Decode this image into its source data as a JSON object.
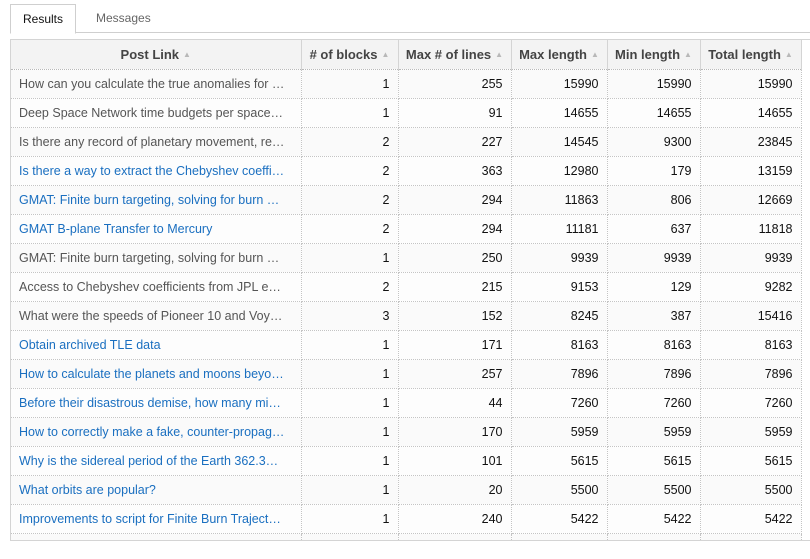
{
  "tabs": [
    {
      "label": "Results",
      "active": true
    },
    {
      "label": "Messages",
      "active": false
    }
  ],
  "table": {
    "columns": [
      "Post Link",
      "# of blocks",
      "Max # of lines",
      "Max length",
      "Min length",
      "Total length"
    ],
    "sort_indicator": "▲",
    "rows": [
      {
        "post": "How can you calculate the true anomalies for …",
        "link": false,
        "blocks": "1",
        "max_lines": "255",
        "max_len": "15990",
        "min_len": "15990",
        "total": "15990"
      },
      {
        "post": "Deep Space Network time budgets per space…",
        "link": false,
        "blocks": "1",
        "max_lines": "91",
        "max_len": "14655",
        "min_len": "14655",
        "total": "14655"
      },
      {
        "post": "Is there any record of planetary movement, re…",
        "link": false,
        "blocks": "2",
        "max_lines": "227",
        "max_len": "14545",
        "min_len": "9300",
        "total": "23845"
      },
      {
        "post": "Is there a way to extract the Chebyshev coeffi…",
        "link": true,
        "blocks": "2",
        "max_lines": "363",
        "max_len": "12980",
        "min_len": "179",
        "total": "13159"
      },
      {
        "post": "GMAT: Finite burn targeting, solving for burn …",
        "link": true,
        "blocks": "2",
        "max_lines": "294",
        "max_len": "11863",
        "min_len": "806",
        "total": "12669"
      },
      {
        "post": "GMAT B-plane Transfer to Mercury",
        "link": true,
        "blocks": "2",
        "max_lines": "294",
        "max_len": "11181",
        "min_len": "637",
        "total": "11818"
      },
      {
        "post": "GMAT: Finite burn targeting, solving for burn …",
        "link": false,
        "blocks": "1",
        "max_lines": "250",
        "max_len": "9939",
        "min_len": "9939",
        "total": "9939"
      },
      {
        "post": "Access to Chebyshev coefficients from JPL e…",
        "link": false,
        "blocks": "2",
        "max_lines": "215",
        "max_len": "9153",
        "min_len": "129",
        "total": "9282"
      },
      {
        "post": "What were the speeds of Pioneer 10 and Voy…",
        "link": false,
        "blocks": "3",
        "max_lines": "152",
        "max_len": "8245",
        "min_len": "387",
        "total": "15416"
      },
      {
        "post": "Obtain archived TLE data",
        "link": true,
        "blocks": "1",
        "max_lines": "171",
        "max_len": "8163",
        "min_len": "8163",
        "total": "8163"
      },
      {
        "post": "How to calculate the planets and moons beyo…",
        "link": true,
        "blocks": "1",
        "max_lines": "257",
        "max_len": "7896",
        "min_len": "7896",
        "total": "7896"
      },
      {
        "post": "Before their disastrous demise, how many mi…",
        "link": true,
        "blocks": "1",
        "max_lines": "44",
        "max_len": "7260",
        "min_len": "7260",
        "total": "7260"
      },
      {
        "post": "How to correctly make a fake, counter-propag…",
        "link": true,
        "blocks": "1",
        "max_lines": "170",
        "max_len": "5959",
        "min_len": "5959",
        "total": "5959"
      },
      {
        "post": "Why is the sidereal period of the Earth 362.3…",
        "link": true,
        "blocks": "1",
        "max_lines": "101",
        "max_len": "5615",
        "min_len": "5615",
        "total": "5615"
      },
      {
        "post": "What orbits are popular?",
        "link": true,
        "blocks": "1",
        "max_lines": "20",
        "max_len": "5500",
        "min_len": "5500",
        "total": "5500"
      },
      {
        "post": "Improvements to script for Finite Burn Traject…",
        "link": true,
        "blocks": "1",
        "max_lines": "240",
        "max_len": "5422",
        "min_len": "5422",
        "total": "5422"
      }
    ]
  }
}
